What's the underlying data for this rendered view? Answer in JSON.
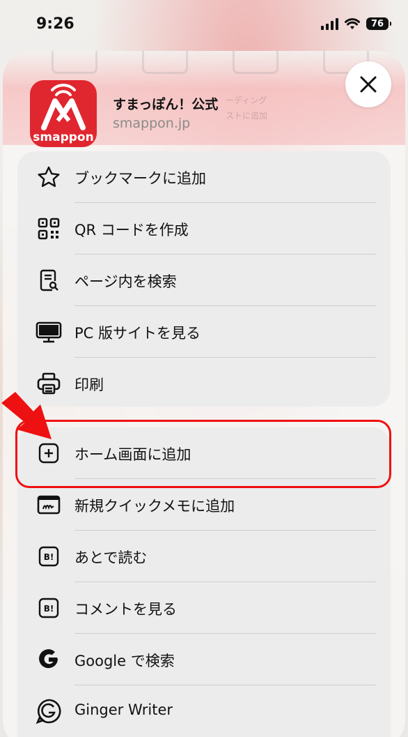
{
  "status_bar": {
    "time": "9:26",
    "battery_level": "76"
  },
  "header": {
    "app_name": "すまっぽん！公式",
    "domain": "smappon.jp",
    "app_icon_word": "smappon"
  },
  "background_ghost": {
    "labels": [
      "ーディング",
      "ストに追加"
    ]
  },
  "menu_group_1": [
    {
      "icon": "star-icon",
      "label": "ブックマークに追加"
    },
    {
      "icon": "qr-code-icon",
      "label": "QR コードを作成"
    },
    {
      "icon": "find-in-page-icon",
      "label": "ページ内を検索"
    },
    {
      "icon": "desktop-icon",
      "label": "PC 版サイトを見る"
    },
    {
      "icon": "printer-icon",
      "label": "印刷"
    }
  ],
  "menu_group_2": [
    {
      "icon": "plus-square-icon",
      "label": "ホーム画面に追加",
      "highlighted": true
    },
    {
      "icon": "quick-note-icon",
      "label": "新規クイックメモに追加"
    },
    {
      "icon": "hatena-bookmark-icon",
      "label": "あとで読む"
    },
    {
      "icon": "hatena-bookmark-icon",
      "label": "コメントを見る"
    },
    {
      "icon": "google-icon",
      "label": "Google で検索"
    },
    {
      "icon": "ginger-icon",
      "label": "Ginger Writer"
    }
  ],
  "colors": {
    "accent_red": "#ee1111",
    "app_icon_red": "#e0262f",
    "menu_background": "#ececec",
    "separator": "#cfcfcf"
  }
}
